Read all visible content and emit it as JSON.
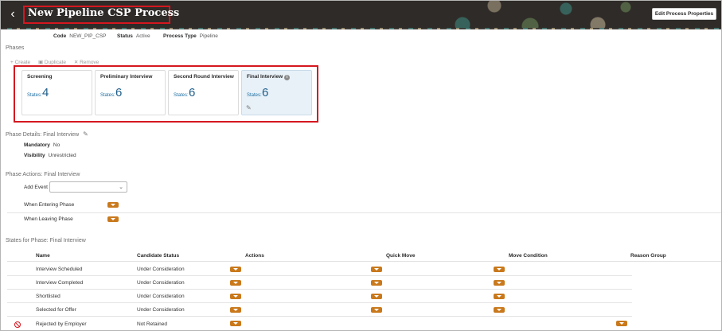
{
  "header": {
    "title": "New Pipeline CSP Process",
    "edit_label": "Edit Process Properties"
  },
  "meta": {
    "code_label": "Code",
    "code_value": "NEW_PIP_CSP",
    "status_label": "Status",
    "status_value": "Active",
    "type_label": "Process Type",
    "type_value": "Pipeline"
  },
  "phases": {
    "heading": "Phases",
    "toolbar": {
      "create": "Create",
      "duplicate": "Duplicate",
      "remove": "Remove"
    },
    "states_label": "States:",
    "cards": [
      {
        "name": "Screening",
        "count": "4"
      },
      {
        "name": "Preliminary Interview",
        "count": "6"
      },
      {
        "name": "Second Round Interview",
        "count": "6"
      },
      {
        "name": "Final Interview",
        "count": "6"
      }
    ]
  },
  "phase_details": {
    "heading": "Phase Details: Final Interview",
    "mandatory_label": "Mandatory",
    "mandatory_value": "No",
    "visibility_label": "Visibility",
    "visibility_value": "Unrestricted"
  },
  "phase_actions": {
    "heading": "Phase Actions: Final Interview",
    "add_event_label": "Add Event",
    "entering_label": "When Entering Phase",
    "leaving_label": "When Leaving Phase"
  },
  "states": {
    "heading": "States for Phase: Final Interview",
    "columns": [
      "Name",
      "Candidate Status",
      "Actions",
      "Quick Move",
      "Move Condition",
      "Reason Group"
    ],
    "rows": [
      {
        "name": "Interview Scheduled",
        "status": "Under Consideration"
      },
      {
        "name": "Interview Completed",
        "status": "Under Consideration"
      },
      {
        "name": "Shortlisted",
        "status": "Under Consideration"
      },
      {
        "name": "Selected for Offer",
        "status": "Under Consideration"
      },
      {
        "name": "Rejected by Employer",
        "status": "Not Retained"
      }
    ]
  },
  "colors": {
    "accent_orange": "#c9791c",
    "highlight_red": "#d5171f",
    "header_bg": "#2f2b28",
    "selected_card": "#e8f1f8"
  }
}
